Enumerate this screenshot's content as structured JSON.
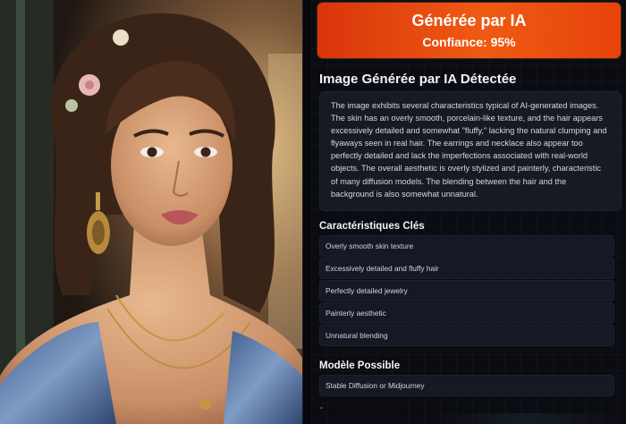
{
  "verdict": {
    "title": "Générée par IA",
    "confidence": "Confiance: 95%",
    "color": "#f0520f"
  },
  "analysis": {
    "heading": "Image Générée par IA Détectée",
    "description": "The image exhibits several characteristics typical of AI-generated images. The skin has an overly smooth, porcelain-like texture, and the hair appears excessively detailed and somewhat \"fluffy,\" lacking the natural clumping and flyaways seen in real hair. The earrings and necklace also appear too perfectly detailed and lack the imperfections associated with real-world objects. The overall aesthetic is overly stylized and painterly, characteristic of many diffusion models. The blending between the hair and the background is also somewhat unnatural."
  },
  "key_characteristics": {
    "heading": "Caractéristiques Clés",
    "items": [
      "Overly smooth skin texture",
      "Excessively detailed and fluffy hair",
      "Perfectly detailed jewelry",
      "Painterly aesthetic",
      "Unnatural blending"
    ]
  },
  "possible_model": {
    "heading": "Modèle Possible",
    "value": "Stable Diffusion or Midjourney"
  }
}
